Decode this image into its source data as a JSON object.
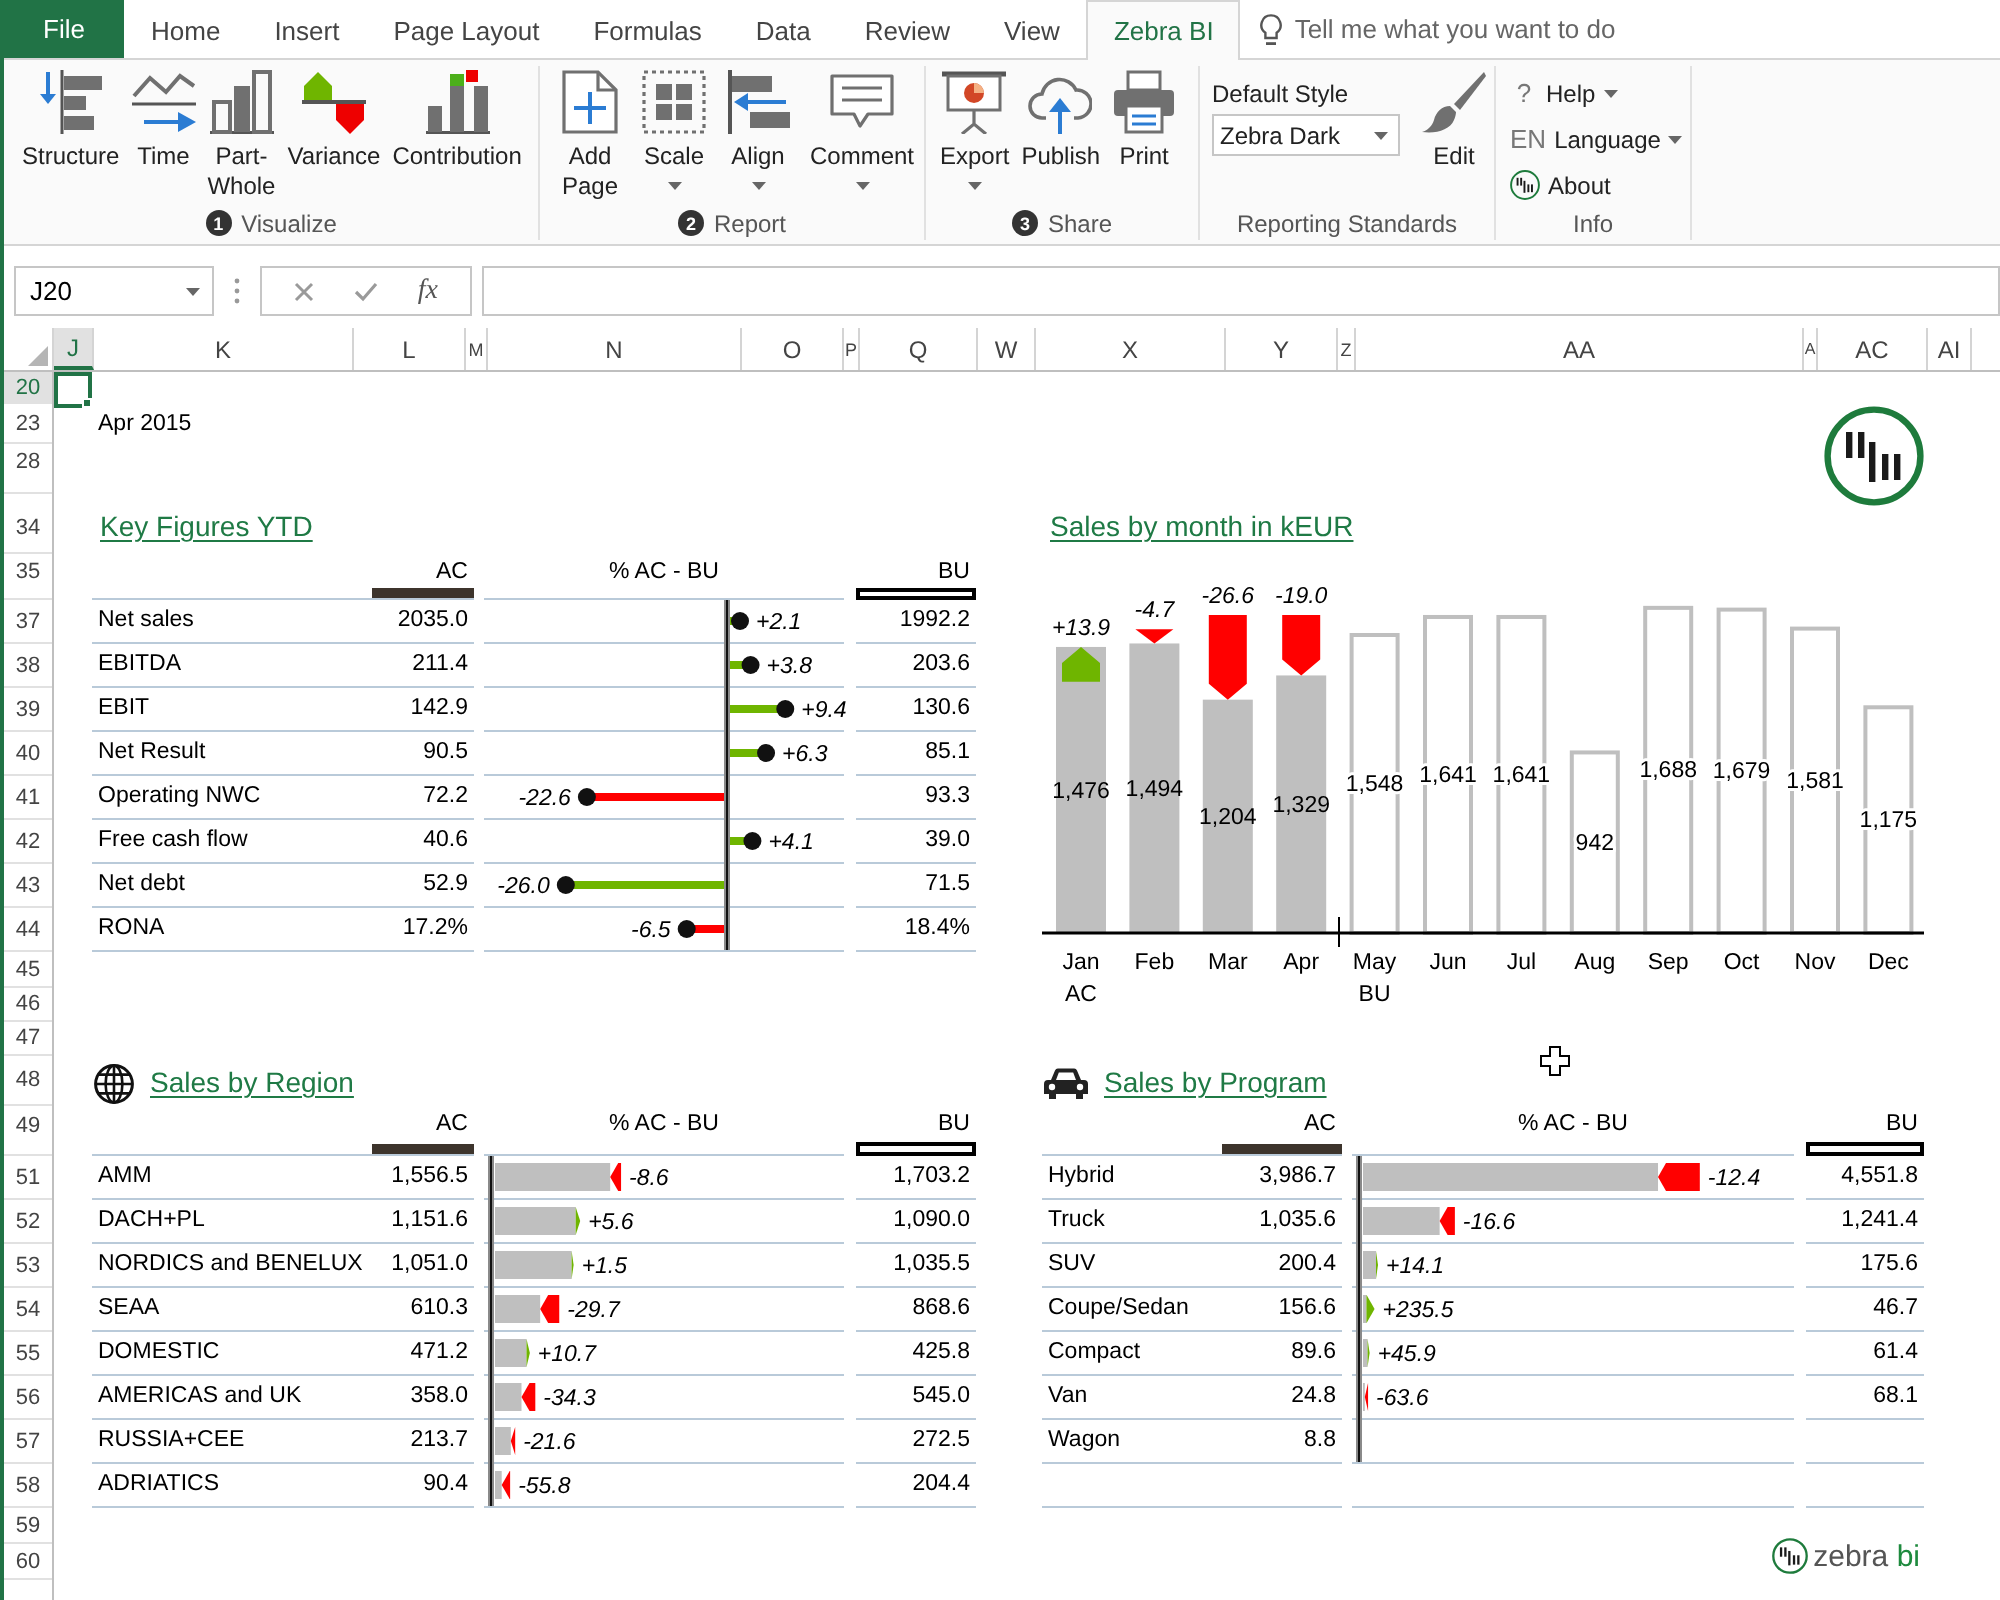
{
  "ribbon_tabs": [
    {
      "label": "File",
      "kind": "file",
      "selected": false
    },
    {
      "label": "Home",
      "kind": "tab",
      "selected": false
    },
    {
      "label": "Insert",
      "kind": "tab",
      "selected": false
    },
    {
      "label": "Page Layout",
      "kind": "tab",
      "selected": false
    },
    {
      "label": "Formulas",
      "kind": "tab",
      "selected": false
    },
    {
      "label": "Data",
      "kind": "tab",
      "selected": false
    },
    {
      "label": "Review",
      "kind": "tab",
      "selected": false
    },
    {
      "label": "View",
      "kind": "tab",
      "selected": false
    },
    {
      "label": "Zebra BI",
      "kind": "tab",
      "selected": true
    }
  ],
  "tell_me": {
    "placeholder": "Tell me what you want to do"
  },
  "ribbon_groups": [
    {
      "number": "1",
      "label": "Visualize",
      "items": [
        {
          "kind": "button",
          "label": "Structure",
          "dropdown": false
        },
        {
          "kind": "button",
          "label": "Time",
          "dropdown": false
        },
        {
          "kind": "button",
          "label": "Part-Whole",
          "dropdown": false
        },
        {
          "kind": "button",
          "label": "Variance",
          "dropdown": false
        },
        {
          "kind": "button",
          "label": "Contribution",
          "dropdown": false
        }
      ]
    },
    {
      "number": "2",
      "label": "Report",
      "items": [
        {
          "kind": "button",
          "label": "Add Page",
          "dropdown": false
        },
        {
          "kind": "button",
          "label": "Scale",
          "dropdown": true
        },
        {
          "kind": "button",
          "label": "Align",
          "dropdown": true
        },
        {
          "kind": "button",
          "label": "Comment",
          "dropdown": true
        }
      ]
    },
    {
      "number": "3",
      "label": "Share",
      "items": [
        {
          "kind": "button",
          "label": "Export",
          "dropdown": true
        },
        {
          "kind": "button",
          "label": "Publish",
          "dropdown": false
        },
        {
          "kind": "button",
          "label": "Print",
          "dropdown": false
        }
      ]
    },
    {
      "label": "Reporting Standards",
      "items": [
        {
          "kind": "style_picker",
          "label": "Default Style",
          "value": "Zebra Dark"
        },
        {
          "kind": "button",
          "label": "Edit",
          "dropdown": false
        }
      ]
    },
    {
      "label": "Info",
      "items": [
        {
          "kind": "link",
          "glyph": "?",
          "label": "Help",
          "dropdown": true
        },
        {
          "kind": "link",
          "glyph": "EN",
          "label": "Language",
          "dropdown": true
        },
        {
          "kind": "link",
          "label": "About",
          "dropdown": false
        }
      ]
    }
  ],
  "formula_bar": {
    "name_box": "J20",
    "function_button": "fx"
  },
  "column_headers": [
    {
      "label": "J",
      "selected": true
    },
    {
      "label": "K",
      "selected": false
    },
    {
      "label": "L",
      "selected": false
    },
    {
      "label": "M",
      "selected": false
    },
    {
      "label": "N",
      "selected": false
    },
    {
      "label": "O",
      "selected": false
    },
    {
      "label": "P",
      "selected": false
    },
    {
      "label": "Q",
      "selected": false
    },
    {
      "label": "W",
      "selected": false
    },
    {
      "label": "X",
      "selected": false
    },
    {
      "label": "Y",
      "selected": false
    },
    {
      "label": "Z",
      "selected": false
    },
    {
      "label": "AA",
      "selected": false
    },
    {
      "label": "A",
      "selected": false
    },
    {
      "label": "AC",
      "selected": false
    },
    {
      "label": "AI",
      "selected": false
    }
  ],
  "row_headers": [
    {
      "label": "20",
      "selected": true
    },
    {
      "label": "23",
      "selected": false
    },
    {
      "label": "28",
      "selected": false
    },
    {
      "label": "34",
      "selected": false
    },
    {
      "label": "35",
      "selected": false
    },
    {
      "label": "37",
      "selected": false
    },
    {
      "label": "38",
      "selected": false
    },
    {
      "label": "39",
      "selected": false
    },
    {
      "label": "40",
      "selected": false
    },
    {
      "label": "41",
      "selected": false
    },
    {
      "label": "42",
      "selected": false
    },
    {
      "label": "43",
      "selected": false
    },
    {
      "label": "44",
      "selected": false
    },
    {
      "label": "45",
      "selected": false
    },
    {
      "label": "46",
      "selected": false
    },
    {
      "label": "47",
      "selected": false
    },
    {
      "label": "48",
      "selected": false
    },
    {
      "label": "49",
      "selected": false
    },
    {
      "label": "51",
      "selected": false
    },
    {
      "label": "52",
      "selected": false
    },
    {
      "label": "53",
      "selected": false
    },
    {
      "label": "54",
      "selected": false
    },
    {
      "label": "55",
      "selected": false
    },
    {
      "label": "56",
      "selected": false
    },
    {
      "label": "57",
      "selected": false
    },
    {
      "label": "58",
      "selected": false
    },
    {
      "label": "59",
      "selected": false
    },
    {
      "label": "60",
      "selected": false
    }
  ],
  "date_label": "Apr 2015",
  "key_figures": {
    "title": "Key Figures YTD",
    "columns": [
      "AC",
      "% AC - BU",
      "BU"
    ],
    "rows": [
      {
        "label": "Net sales",
        "ac": "2035.0",
        "delta": "+2.1",
        "color": "#6fb500",
        "bu": "1992.2"
      },
      {
        "label": "EBITDA",
        "ac": "211.4",
        "delta": "+3.8",
        "color": "#6fb500",
        "bu": "203.6"
      },
      {
        "label": "EBIT",
        "ac": "142.9",
        "delta": "+9.4",
        "color": "#6fb500",
        "bu": "130.6"
      },
      {
        "label": "Net Result",
        "ac": "90.5",
        "delta": "+6.3",
        "color": "#6fb500",
        "bu": "85.1"
      },
      {
        "label": "Operating NWC",
        "ac": "72.2",
        "delta": "-22.6",
        "color": "#ff0000",
        "bu": "93.3"
      },
      {
        "label": "Free cash flow",
        "ac": "40.6",
        "delta": "+4.1",
        "color": "#6fb500",
        "bu": "39.0"
      },
      {
        "label": "Net debt",
        "ac": "52.9",
        "delta": "-26.0",
        "color": "#6fb500",
        "bu": "71.5"
      },
      {
        "label": "RONA",
        "ac": "17.2%",
        "delta": "-6.5",
        "color": "#ff0000",
        "bu": "18.4%"
      }
    ]
  },
  "sales_by_month": {
    "chart_data": {
      "type": "bar",
      "title": "Sales by month in kEUR",
      "categories": [
        "Jan",
        "Feb",
        "Mar",
        "Apr",
        "May",
        "Jun",
        "Jul",
        "Aug",
        "Sep",
        "Oct",
        "Nov",
        "Dec"
      ],
      "series": [
        {
          "name": "AC",
          "color": "#bfbfbf",
          "values": [
            1476,
            1494,
            1204,
            1329,
            null,
            null,
            null,
            null,
            null,
            null,
            null,
            null
          ],
          "value_labels": [
            "1,476",
            "1,494",
            "1,204",
            "1,329",
            null,
            null,
            null,
            null,
            null,
            null,
            null,
            null
          ]
        },
        {
          "name": "BU",
          "color": "#bfbfbf",
          "values": [
            null,
            null,
            null,
            null,
            1548,
            1641,
            1641,
            942,
            1688,
            1679,
            1581,
            1175
          ],
          "value_labels": [
            null,
            null,
            null,
            null,
            "1,548",
            "1,641",
            "1,641",
            "942",
            "1,688",
            "1,679",
            "1,581",
            "1,175"
          ]
        }
      ],
      "annotations": [
        "+13.9",
        "-4.7",
        "-26.6",
        "-19.0"
      ]
    }
  },
  "sales_by_region": {
    "title": "Sales by Region",
    "columns": [
      "AC",
      "% AC - BU",
      "BU"
    ],
    "rows": [
      {
        "label": "AMM",
        "ac": "1,556.5",
        "delta": "-8.6",
        "color": "#ff0000",
        "bu": "1,703.2"
      },
      {
        "label": "DACH+PL",
        "ac": "1,151.6",
        "delta": "+5.6",
        "color": "#6fb500",
        "bu": "1,090.0"
      },
      {
        "label": "NORDICS and BENELUX",
        "ac": "1,051.0",
        "delta": "+1.5",
        "color": "#6fb500",
        "bu": "1,035.5"
      },
      {
        "label": "SEAA",
        "ac": "610.3",
        "delta": "-29.7",
        "color": "#ff0000",
        "bu": "868.6"
      },
      {
        "label": "DOMESTIC",
        "ac": "471.2",
        "delta": "+10.7",
        "color": "#6fb500",
        "bu": "425.8"
      },
      {
        "label": "AMERICAS and UK",
        "ac": "358.0",
        "delta": "-34.3",
        "color": "#ff0000",
        "bu": "545.0"
      },
      {
        "label": "RUSSIA+CEE",
        "ac": "213.7",
        "delta": "-21.6",
        "color": "#ff0000",
        "bu": "272.5"
      },
      {
        "label": "ADRIATICS",
        "ac": "90.4",
        "delta": "-55.8",
        "color": "#ff0000",
        "bu": "204.4"
      }
    ]
  },
  "sales_by_program": {
    "title": "Sales by Program",
    "columns": [
      "AC",
      "% AC - BU",
      "BU"
    ],
    "rows": [
      {
        "label": "Hybrid",
        "ac": "3,986.7",
        "delta": "-12.4",
        "color": "#ff0000",
        "bu": "4,551.8"
      },
      {
        "label": "Truck",
        "ac": "1,035.6",
        "delta": "-16.6",
        "color": "#ff0000",
        "bu": "1,241.4"
      },
      {
        "label": "SUV",
        "ac": "200.4",
        "delta": "+14.1",
        "color": "#6fb500",
        "bu": "175.6"
      },
      {
        "label": "Coupe/Sedan",
        "ac": "156.6",
        "delta": "+235.5",
        "color": "#6fb500",
        "bu": "46.7"
      },
      {
        "label": "Compact",
        "ac": "89.6",
        "delta": "+45.9",
        "color": "#6fb500",
        "bu": "61.4"
      },
      {
        "label": "Van",
        "ac": "24.8",
        "delta": "-63.6",
        "color": "#ff0000",
        "bu": "68.1"
      },
      {
        "label": "Wagon",
        "ac": "8.8"
      }
    ]
  },
  "brand": "zebra bi"
}
